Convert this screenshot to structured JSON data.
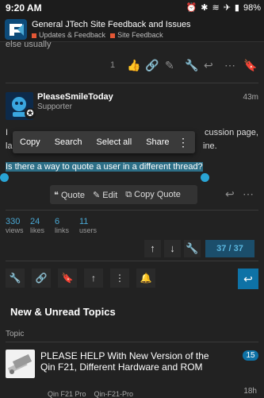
{
  "status_bar": {
    "time": "9:20 AM",
    "battery": "98%"
  },
  "header": {
    "title": "General JTech Site Feedback and Issues",
    "categories": [
      {
        "label": "Updates & Feedback",
        "color": "#e45735"
      },
      {
        "label": "Site Feedback",
        "color": "#e45735"
      }
    ]
  },
  "previous_post": {
    "tail_text": "else usually",
    "likes_count": "1"
  },
  "post": {
    "username": "PleaseSmileToday",
    "user_title": "Supporter",
    "age": "43m",
    "body_line1_start": "I",
    "body_line1_end": "cussion page,",
    "body_line2_start": "la",
    "body_line2_end": "ine.",
    "selected_text": "Is there a way to quote a user in a different thread?"
  },
  "context_menu": {
    "items": [
      "Copy",
      "Search",
      "Select all",
      "Share"
    ]
  },
  "quote_bar": {
    "quote_label": "Quote",
    "edit_label": "Edit",
    "copy_quote_label": "Copy Quote"
  },
  "stats": [
    {
      "num": "330",
      "label": "views"
    },
    {
      "num": "24",
      "label": "likes"
    },
    {
      "num": "6",
      "label": "links"
    },
    {
      "num": "11",
      "label": "users"
    }
  ],
  "progress": "37 / 37",
  "new_unread": {
    "title": "New & Unread Topics",
    "column_header": "Topic",
    "topic": {
      "title": "PLEASE HELP With New Version of the Qin F21, Different Hardware and ROM",
      "badge": "15",
      "age": "18h",
      "tags": [
        "Qin F21 Pro",
        "Qin-F21-Pro"
      ]
    }
  },
  "colors": {
    "accent": "#0e72a6",
    "link": "#4aa8d4",
    "background": "#222222",
    "selection": "#2c6e86"
  }
}
